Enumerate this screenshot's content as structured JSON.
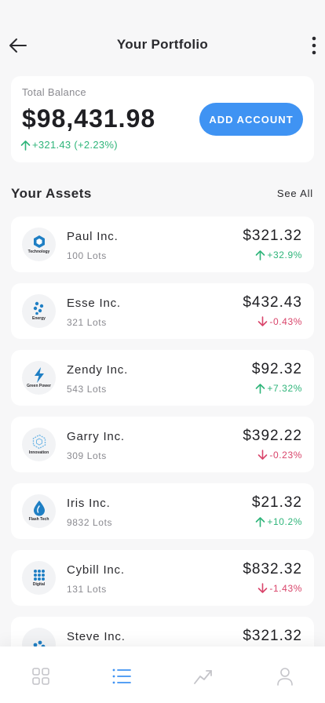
{
  "header": {
    "title": "Your Portfolio"
  },
  "balance": {
    "label": "Total Balance",
    "amount": "$98,431.98",
    "change": "+321.43 (+2.23%)",
    "add_account_label": "ADD ACCOUNT"
  },
  "assets_section": {
    "title": "Your Assets",
    "see_all_label": "See All"
  },
  "assets": [
    {
      "name": "Paul Inc.",
      "lots": "100 Lots",
      "price": "$321.32",
      "change": "+32.9%",
      "direction": "up",
      "logo_label": "Technology",
      "logo_icon": "hexagon-icon"
    },
    {
      "name": "Esse Inc.",
      "lots": "321 Lots",
      "price": "$432.43",
      "change": "-0.43%",
      "direction": "down",
      "logo_label": "Energy",
      "logo_icon": "molecule-icon"
    },
    {
      "name": "Zendy Inc.",
      "lots": "543 Lots",
      "price": "$92.32",
      "change": "+7.32%",
      "direction": "up",
      "logo_label": "Green Power",
      "logo_icon": "lightning-icon"
    },
    {
      "name": "Garry Inc.",
      "lots": "309 Lots",
      "price": "$392.22",
      "change": "-0.23%",
      "direction": "down",
      "logo_label": "Innovation",
      "logo_icon": "hex-outline-icon"
    },
    {
      "name": "Iris Inc.",
      "lots": "9832 Lots",
      "price": "$21.32",
      "change": "+10.2%",
      "direction": "up",
      "logo_label": "Flash Tech",
      "logo_icon": "drop-icon"
    },
    {
      "name": "Cybill Inc.",
      "lots": "131 Lots",
      "price": "$832.32",
      "change": "-1.43%",
      "direction": "down",
      "logo_label": "Digital",
      "logo_icon": "dots-grid-icon"
    },
    {
      "name": "Steve Inc.",
      "lots": "",
      "price": "$321.32",
      "change": "",
      "direction": "up",
      "logo_label": "",
      "logo_icon": "molecule-icon"
    }
  ],
  "colors": {
    "accent": "#3f93f3",
    "up": "#2fb57a",
    "down": "#d9456b",
    "logo_blue": "#1f7fc4"
  },
  "nav": [
    {
      "icon": "grid-icon",
      "active": false
    },
    {
      "icon": "list-icon",
      "active": true
    },
    {
      "icon": "trend-chart-icon",
      "active": false
    },
    {
      "icon": "profile-icon",
      "active": false
    }
  ]
}
